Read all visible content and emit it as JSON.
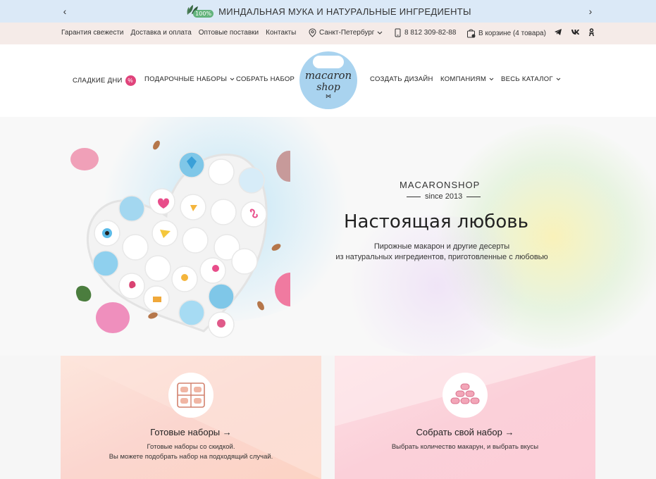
{
  "promo": {
    "badge": "100%",
    "text": "МИНДАЛЬНАЯ МУКА И НАТУРАЛЬНЫЕ ИНГРЕДИЕНТЫ",
    "prev": "‹",
    "next": "›"
  },
  "util": {
    "links": [
      "Гарантия свежести",
      "Доставка и оплата",
      "Оптовые поставки",
      "Контакты"
    ],
    "city": "Санкт-Петербург",
    "phone": "8 812 309-82-88",
    "cart": "В корзине (4 товара)",
    "cart_count": "4",
    "social": [
      "telegram-icon",
      "vk-icon",
      "ok-icon"
    ]
  },
  "nav": {
    "sweet_days": "СЛАДКИЕ ДНИ",
    "sweet_badge": "%",
    "gift_sets": "ПОДАРОЧНЫЕ НАБОРЫ",
    "build_set": "СОБРАТЬ НАБОР",
    "design": "СОЗДАТЬ ДИЗАЙН",
    "companies": "КОМПАНИЯМ",
    "catalog": "ВЕСЬ КАТАЛОГ",
    "logo_line1": "macaron",
    "logo_line2": "shop",
    "logo_bow": "⋈"
  },
  "hero": {
    "brand": "MACARONSHOP",
    "since": "since 2013",
    "title": "Настоящая любовь",
    "subtitle_1": "Пирожные макарон и другие десерты",
    "subtitle_2": "из натуральных ингредиентов, приготовленные с любовью"
  },
  "cards": [
    {
      "title": "Готовые наборы",
      "arrow": "→",
      "desc_1": "Готовые наборы со скидкой.",
      "desc_2": "Вы можете подобрать набор на подходящий случай."
    },
    {
      "title": "Собрать свой набор",
      "arrow": "→",
      "desc_1": "Выбрать количество макарун, и выбрать вкусы",
      "desc_2": ""
    }
  ],
  "colors": {
    "promo_bg": "#dbe9f7",
    "util_bg": "#f5ebe8",
    "accent_pink": "#e0437b",
    "logo_bg": "#a9d3ef"
  }
}
